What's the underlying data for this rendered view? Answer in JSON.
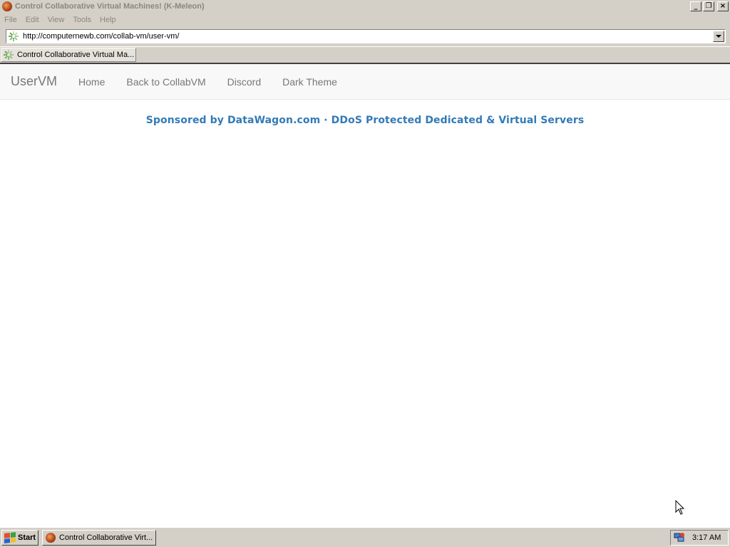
{
  "window": {
    "title": "Control Collaborative Virtual Machines! (K-Meleon)",
    "minimize_icon": "minimize-icon",
    "maximize_icon": "restore-icon",
    "close_icon": "close-icon"
  },
  "menu": {
    "items": [
      "File",
      "Edit",
      "View",
      "Tools",
      "Help"
    ]
  },
  "address": {
    "url": "http://computernewb.com/collab-vm/user-vm/"
  },
  "tab": {
    "label": "Control Collaborative Virtual Ma..."
  },
  "page": {
    "brand": "UserVM",
    "nav": [
      "Home",
      "Back to CollabVM",
      "Discord",
      "Dark Theme"
    ],
    "sponsor": "Sponsored by DataWagon.com · DDoS Protected Dedicated & Virtual Servers",
    "sponsor_color": "#337ab7"
  },
  "taskbar": {
    "start_label": "Start",
    "task_label": "Control Collaborative Virt...",
    "clock": "3:17 AM"
  }
}
